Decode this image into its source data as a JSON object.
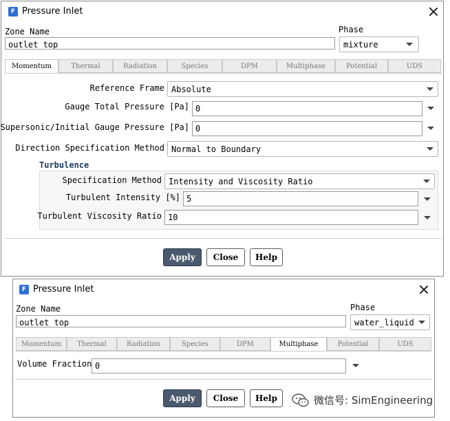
{
  "dialog1": {
    "title": "Pressure Inlet",
    "zone_name_label": "Zone Name",
    "zone_name_value": "outlet_top",
    "phase_label": "Phase",
    "phase_value": "mixture",
    "tabs": [
      "Momentum",
      "Thermal",
      "Radiation",
      "Species",
      "DPM",
      "Multiphase",
      "Potential",
      "UDS"
    ],
    "active_tab": "Momentum",
    "reference_frame_label": "Reference Frame",
    "reference_frame_value": "Absolute",
    "gauge_total_pressure_label": "Gauge Total Pressure [Pa]",
    "gauge_total_pressure_value": "0",
    "supersonic_label": "Supersonic/Initial Gauge Pressure [Pa]",
    "supersonic_value": "0",
    "direction_label": "Direction Specification Method",
    "direction_value": "Normal to Boundary",
    "turbulence_title": "Turbulence",
    "spec_method_label": "Specification Method",
    "spec_method_value": "Intensity and Viscosity Ratio",
    "turb_intensity_label": "Turbulent Intensity [%]",
    "turb_intensity_value": "5",
    "turb_visc_label": "Turbulent Viscosity Ratio",
    "turb_visc_value": "10",
    "buttons": {
      "apply": "Apply",
      "close": "Close",
      "help": "Help"
    }
  },
  "dialog2": {
    "title": "Pressure Inlet",
    "zone_name_label": "Zone Name",
    "zone_name_value": "outlet_top",
    "phase_label": "Phase",
    "phase_value": "water_liquid",
    "tabs": [
      "Momentum",
      "Thermal",
      "Radiation",
      "Species",
      "DPM",
      "Multiphase",
      "Potential",
      "UDS"
    ],
    "active_tab": "Multiphase",
    "volume_fraction_label": "Volume Fraction",
    "volume_fraction_value": "0",
    "buttons": {
      "apply": "Apply",
      "close": "Close",
      "help": "Help"
    }
  },
  "watermark": "微信号: SimEngineering",
  "colors": {
    "app_icon": "#2d6fd6",
    "apply_button": "#4a5a6e",
    "turbulence_title": "#1f3d63"
  },
  "icons": {
    "app": "fluent-app-icon",
    "close": "close-icon",
    "dropdown": "chevron-down-icon",
    "wechat": "wechat-icon"
  }
}
